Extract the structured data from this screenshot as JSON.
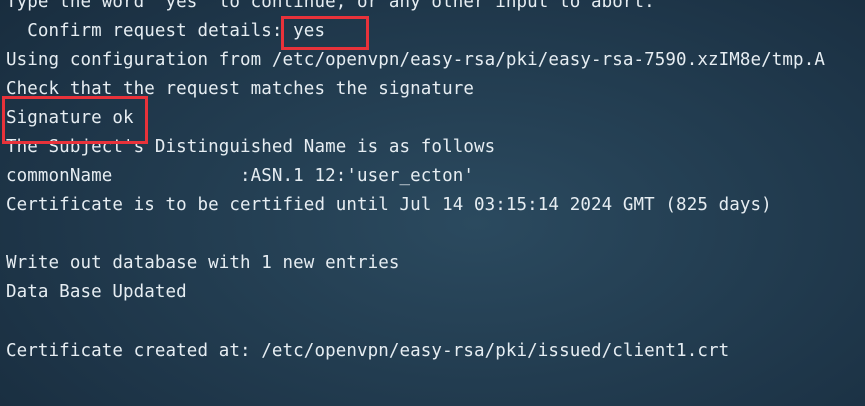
{
  "terminal": {
    "lines": [
      "Type the word 'yes' to continue, or any other input to abort.",
      "  Confirm request details: yes",
      "Using configuration from /etc/openvpn/easy-rsa/pki/easy-rsa-7590.xzIM8e/tmp.A",
      "Check that the request matches the signature",
      "Signature ok",
      "The Subject's Distinguished Name is as follows",
      "commonName            :ASN.1 12:'user_ecton'",
      "Certificate is to be certified until Jul 14 03:15:14 2024 GMT (825 days)",
      "",
      "Write out database with 1 new entries",
      "Data Base Updated",
      "",
      "Certificate created at: /etc/openvpn/easy-rsa/pki/issued/client1.crt"
    ]
  },
  "annotations": {
    "highlight_color": "#e8323a"
  }
}
